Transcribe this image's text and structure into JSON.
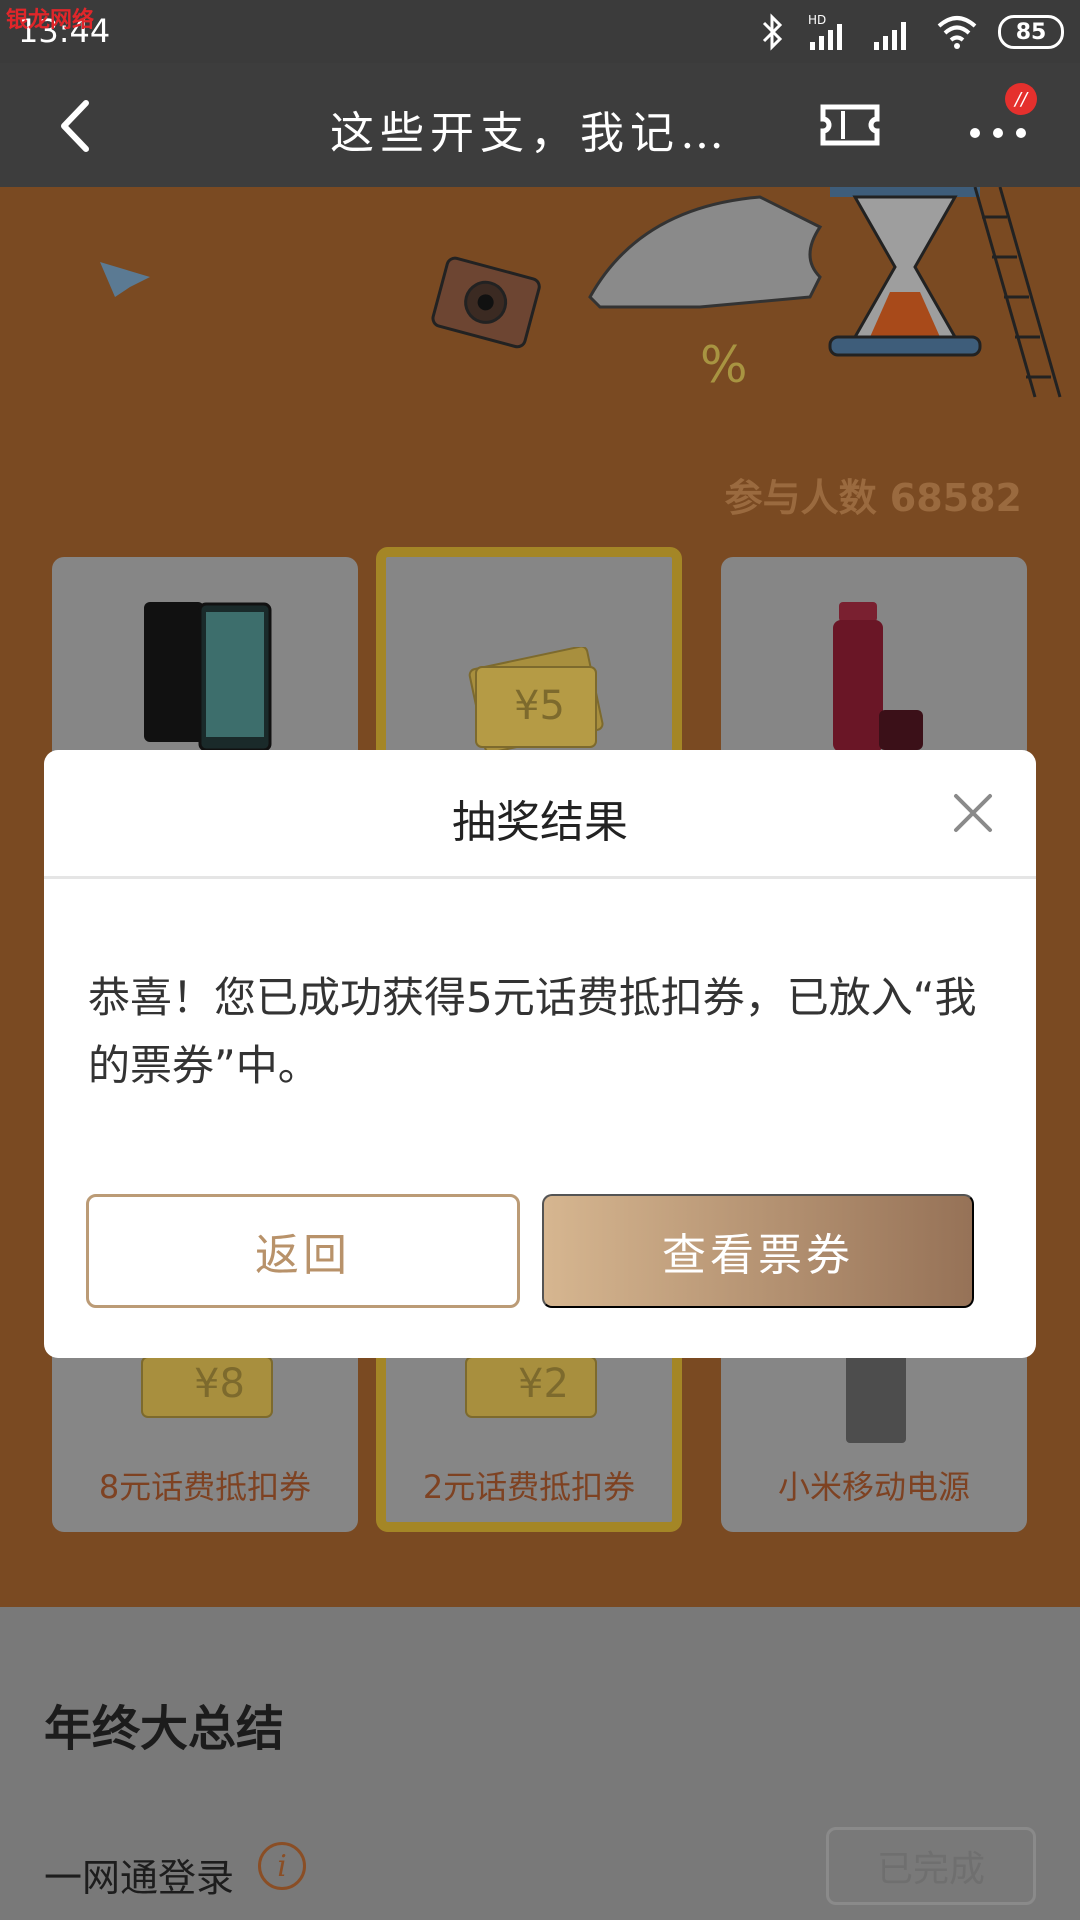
{
  "status_bar": {
    "watermark": "银龙网络",
    "time": "13:44",
    "network_label": "HD",
    "battery": "85"
  },
  "nav": {
    "title": "这些开支，我记…",
    "notification_badge": "//"
  },
  "banner": {
    "participants_text": "参与人数 68582",
    "prizes_top": [
      {
        "icon": "phone-image",
        "coupon_value": ""
      },
      {
        "icon": "coupon-image",
        "coupon_value": "¥5"
      },
      {
        "icon": "thermos-image",
        "coupon_value": ""
      }
    ],
    "prizes_bottom": [
      {
        "label": "8元话费抵扣券",
        "coupon_value": "¥8"
      },
      {
        "label": "2元话费抵扣券",
        "coupon_value": "¥2"
      },
      {
        "label": "小米移动电源",
        "coupon_value": ""
      }
    ]
  },
  "modal": {
    "title": "抽奖结果",
    "message": "恭喜！您已成功获得5元话费抵扣券，已放入“我的票券”中。",
    "return_label": "返回",
    "view_label": "查看票券"
  },
  "summary": {
    "title": "年终大总结",
    "login_label": "一网通登录",
    "info_symbol": "i",
    "done_label": "已完成"
  },
  "colors": {
    "accent": "#c09a74",
    "overlay_orange": "#7a4a22",
    "prize_label": "#7e4222"
  }
}
